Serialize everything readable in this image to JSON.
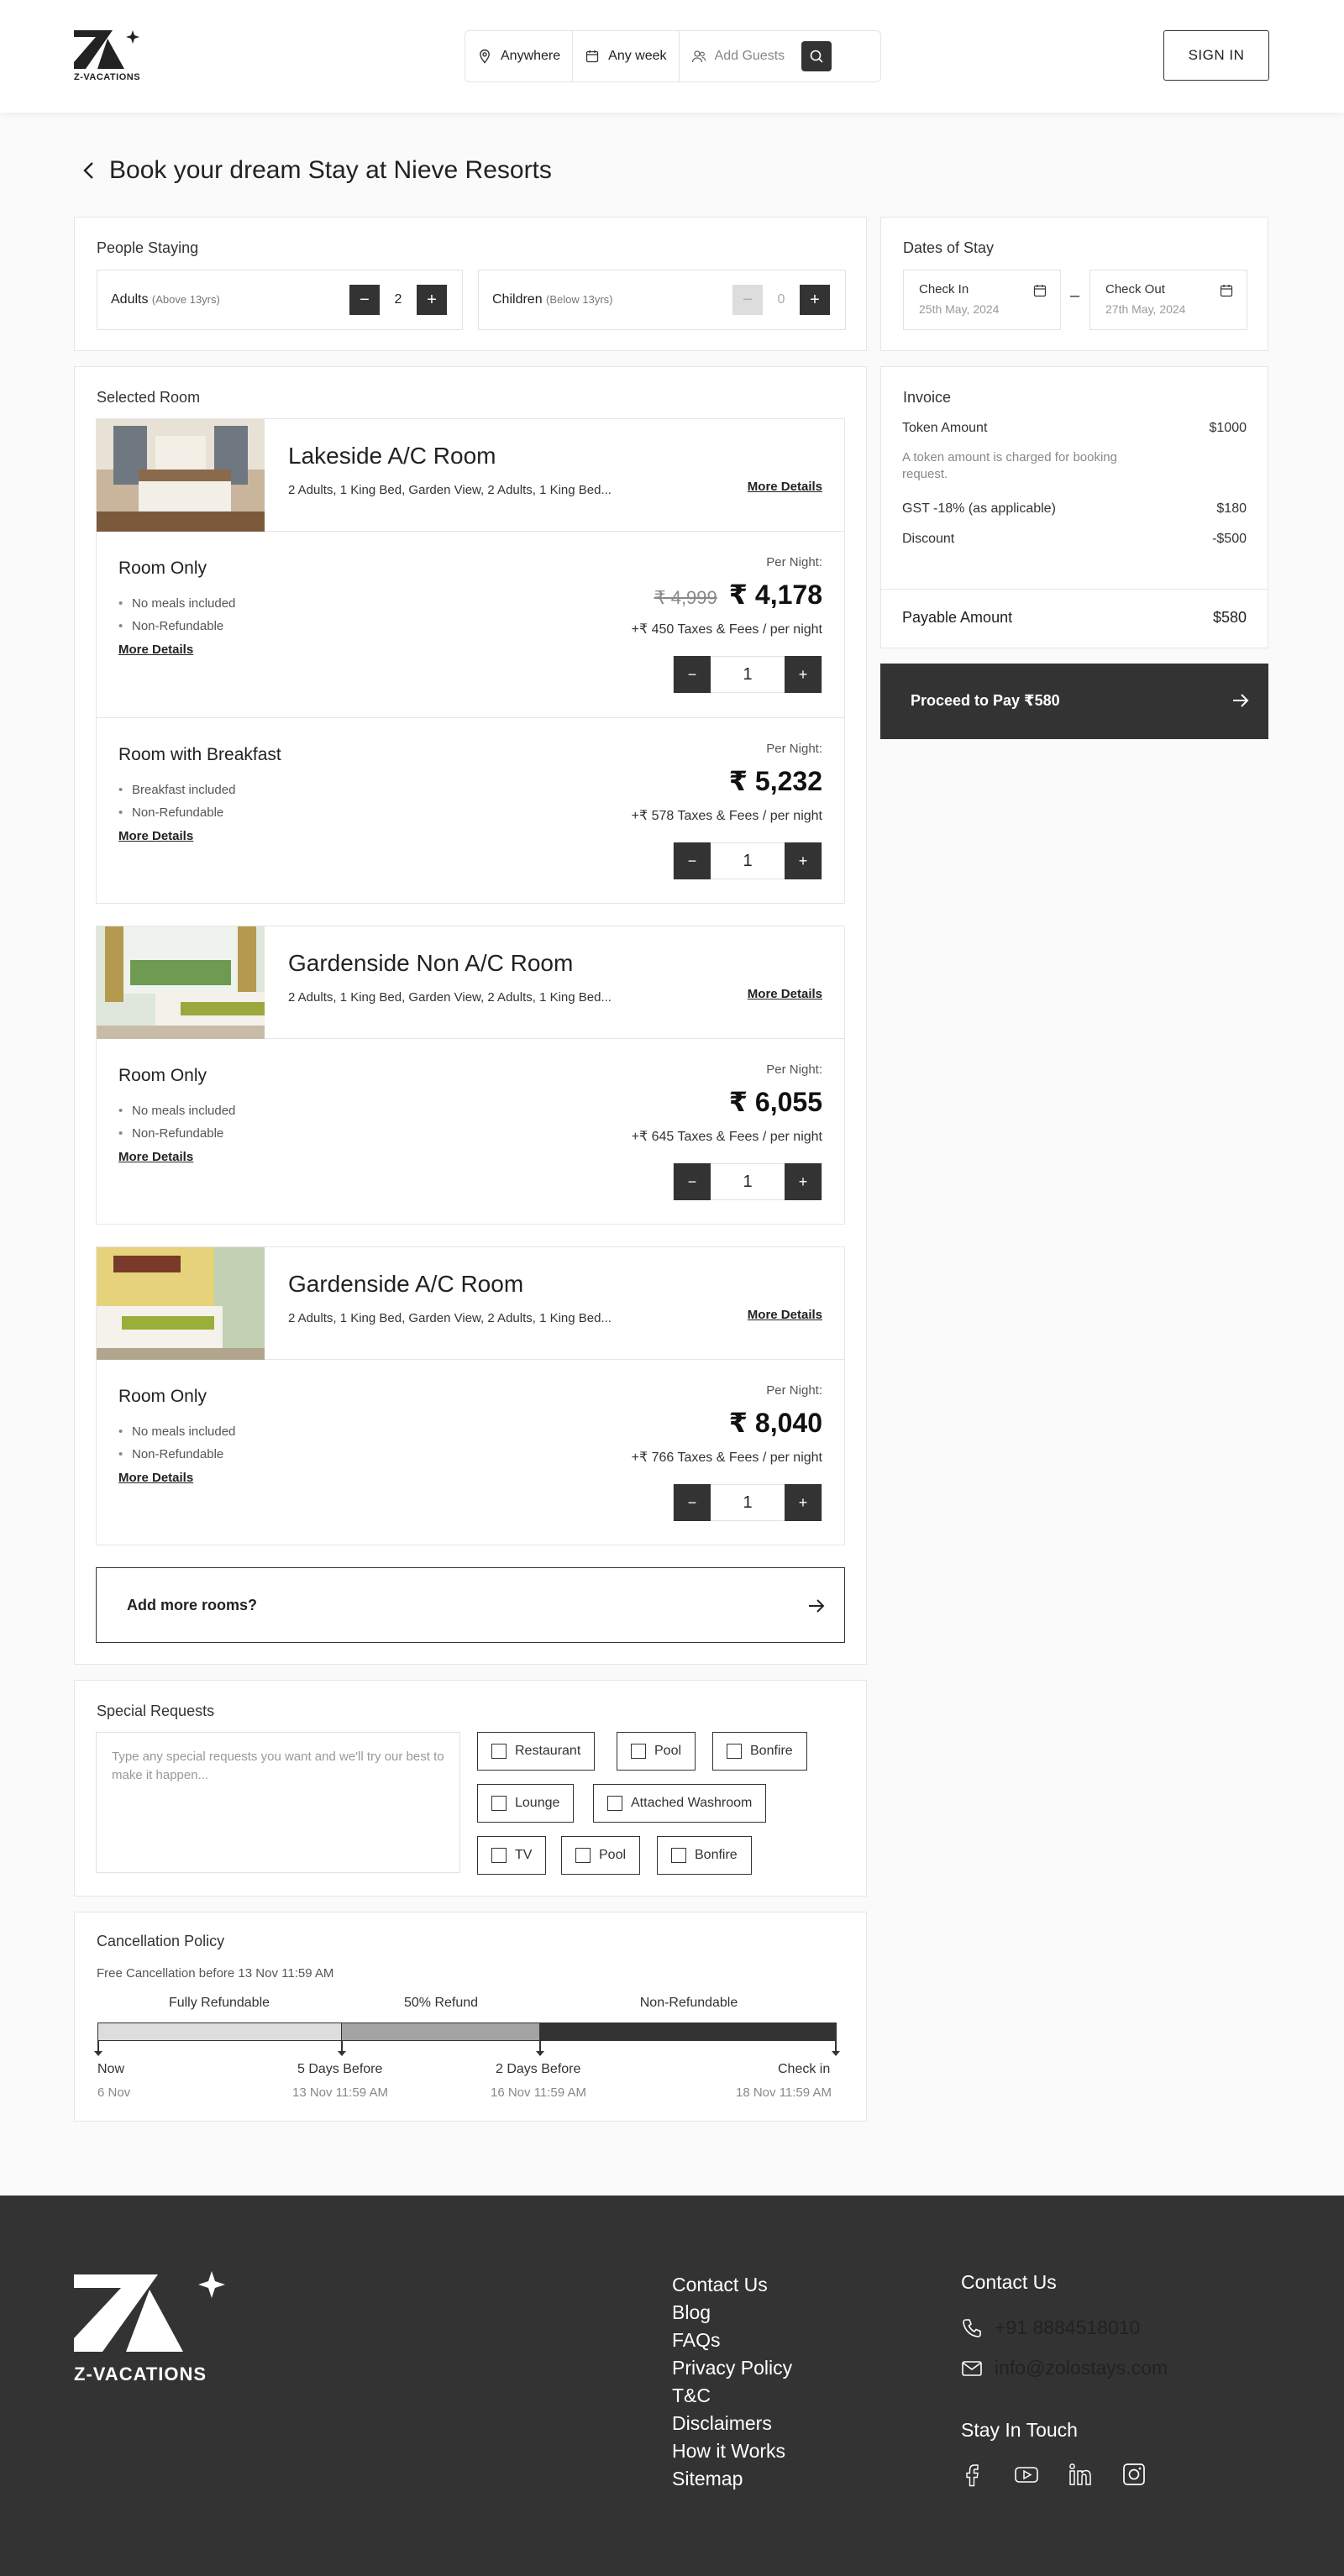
{
  "header": {
    "logo_text": "Z-VACATIONS",
    "search": {
      "where": "Anywhere",
      "when": "Any week",
      "guests_placeholder": "Add Guests"
    },
    "signin_label": "SIGN IN"
  },
  "page_title": "Book your dream Stay at Nieve Resorts",
  "people": {
    "label": "People Staying",
    "adults": {
      "label": "Adults",
      "note": "(Above 13yrs)",
      "value": "2"
    },
    "children": {
      "label": "Children",
      "note": "(Below 13yrs)",
      "value": "0"
    }
  },
  "dates": {
    "label": "Dates of Stay",
    "check_in": {
      "label": "Check In",
      "value": "25th May, 2024"
    },
    "separator": "–",
    "check_out": {
      "label": "Check Out",
      "value": "27th May, 2024"
    }
  },
  "selected_room_label": "Selected Room",
  "more_details": "More Details",
  "per_night_label": "Per Night:",
  "rooms": [
    {
      "name": "Lakeside A/C Room",
      "desc": "2 Adults, 1 King Bed, Garden View, 2 Adults, 1 King Bed...",
      "plans": [
        {
          "name": "Room Only",
          "features": [
            "No meals included",
            "Non-Refundable"
          ],
          "old_price": "₹ 4,999",
          "price": "₹ 4,178",
          "taxes": "+₹ 450 Taxes & Fees / per night",
          "qty": "1"
        },
        {
          "name": "Room with Breakfast",
          "features": [
            "Breakfast included",
            "Non-Refundable"
          ],
          "old_price": "",
          "price": "₹ 5,232",
          "taxes": "+₹ 578 Taxes & Fees / per night",
          "qty": "1"
        }
      ]
    },
    {
      "name": "Gardenside Non A/C Room",
      "desc": "2 Adults, 1 King Bed, Garden View, 2 Adults, 1 King Bed...",
      "plans": [
        {
          "name": "Room Only",
          "features": [
            "No meals included",
            "Non-Refundable"
          ],
          "old_price": "",
          "price": "₹ 6,055",
          "taxes": "+₹ 645 Taxes & Fees / per night",
          "qty": "1"
        }
      ]
    },
    {
      "name": "Gardenside A/C Room",
      "desc": "2 Adults, 1 King Bed, Garden View, 2 Adults, 1 King Bed...",
      "plans": [
        {
          "name": "Room Only",
          "features": [
            "No meals included",
            "Non-Refundable"
          ],
          "old_price": "",
          "price": "₹ 8,040",
          "taxes": "+₹ 766 Taxes & Fees / per night",
          "qty": "1"
        }
      ]
    }
  ],
  "add_rooms_label": "Add more rooms?",
  "invoice": {
    "title": "Invoice",
    "token_label": "Token Amount",
    "token_value": "$1000",
    "token_note": "A token amount is charged for booking request.",
    "gst_label": "GST -18% (as applicable)",
    "gst_value": "$180",
    "discount_label": "Discount",
    "discount_value": "-$500",
    "payable_label": "Payable Amount",
    "payable_value": "$580"
  },
  "pay_button": "Proceed to Pay ₹580",
  "special": {
    "label": "Special Requests",
    "placeholder": "Type any special requests you want and we'll try our best to make it happen...",
    "options": [
      "Restaurant",
      "Pool",
      "Bonfire",
      "Lounge",
      "Attached Washroom",
      "TV",
      "Pool",
      "Bonfire"
    ]
  },
  "cancellation": {
    "title": "Cancellation Policy",
    "subtitle": "Free Cancellation before 13 Nov 11:59 AM",
    "phases": [
      "Fully Refundable",
      "50% Refund",
      "Non-Refundable"
    ],
    "milestones": [
      {
        "label": "Now",
        "date": "6 Nov"
      },
      {
        "label": "5 Days Before",
        "date": "13 Nov 11:59 AM"
      },
      {
        "label": "2 Days Before",
        "date": "16 Nov 11:59 AM"
      },
      {
        "label": "Check in",
        "date": "18 Nov 11:59 AM"
      }
    ]
  },
  "footer": {
    "logo_text": "Z-VACATIONS",
    "links": [
      "Contact Us",
      "Blog",
      "FAQs",
      "Privacy Policy",
      "T&C",
      "Disclaimers",
      "How it Works",
      "Sitemap"
    ],
    "contact_title": "Contact Us",
    "phone": "+91 8884518010",
    "email": "info@zolostays.com",
    "stay_title": "Stay In Touch",
    "socials": [
      "facebook-icon",
      "youtube-icon",
      "linkedin-icon",
      "instagram-icon"
    ]
  },
  "colors": {
    "dark": "#333333",
    "border": "#e6e6e6",
    "muted": "#888888"
  }
}
